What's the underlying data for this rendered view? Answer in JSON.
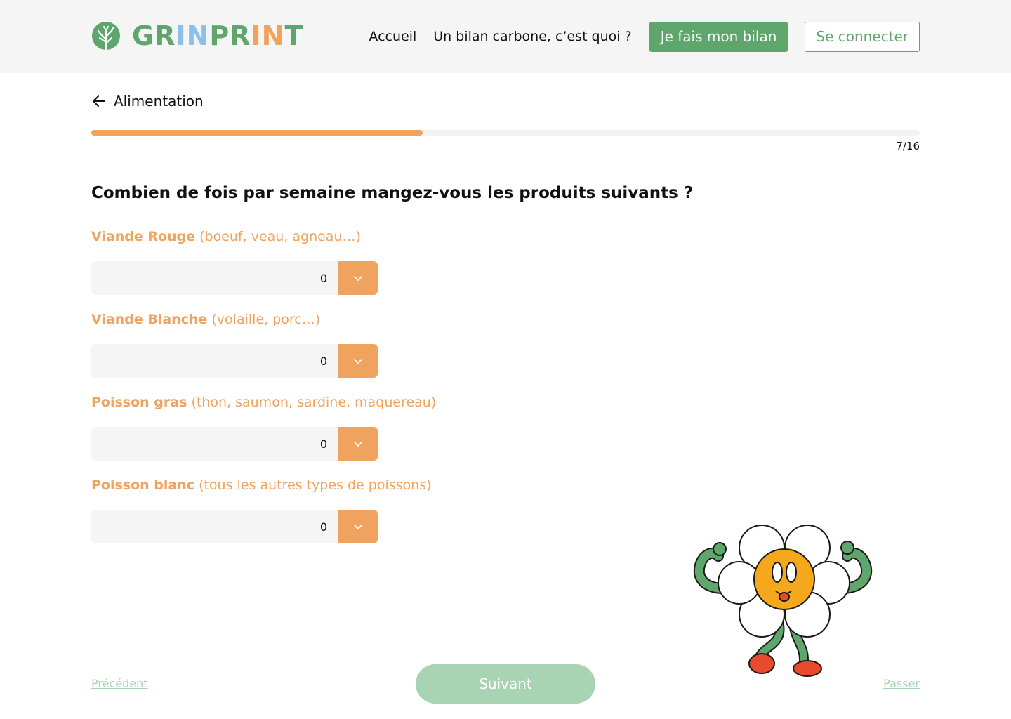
{
  "brand": {
    "parts": [
      "GR",
      "IN",
      "PR",
      "IN",
      "T"
    ],
    "colors": {
      "green": "#5ea66c",
      "blue": "#8cc0e8",
      "orange": "#f0a35e"
    }
  },
  "nav": {
    "home": "Accueil",
    "about": "Un bilan carbone, c’est quoi ?",
    "cta": "Je fais mon bilan",
    "login": "Se connecter"
  },
  "breadcrumb": {
    "label": "Alimentation",
    "icon": "arrow-left-icon"
  },
  "progress": {
    "current": 7,
    "total": 16,
    "text": "7/16",
    "fraction": 0.4
  },
  "question": "Combien de fois par semaine mangez-vous les produits suivants ?",
  "fields": [
    {
      "name": "Viande Rouge",
      "hint": " (boeuf, veau, agneau…)",
      "value": "0"
    },
    {
      "name": "Viande Blanche",
      "hint": " (volaille, porc…)",
      "value": "0"
    },
    {
      "name": "Poisson gras",
      "hint": " (thon, saumon, sardine, maquereau)",
      "value": "0"
    },
    {
      "name": "Poisson blanc",
      "hint": " (tous les autres types de poissons)",
      "value": "0"
    }
  ],
  "footer": {
    "prev": "Précédent",
    "next": "Suivant",
    "skip": "Passer"
  }
}
